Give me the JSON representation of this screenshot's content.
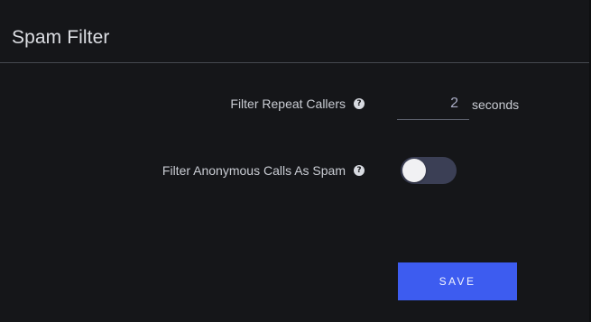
{
  "page": {
    "title": "Spam Filter"
  },
  "settings": {
    "repeat_callers": {
      "label": "Filter Repeat Callers",
      "help_icon": "question-circle-icon",
      "value": "2",
      "unit": "seconds"
    },
    "anonymous_calls": {
      "label": "Filter Anonymous Calls As Spam",
      "help_icon": "question-circle-icon",
      "enabled": false
    }
  },
  "actions": {
    "save_label": "SAVE"
  },
  "colors": {
    "background": "#151619",
    "accent": "#3d5cf0",
    "toggle_track": "#3b3f55"
  }
}
